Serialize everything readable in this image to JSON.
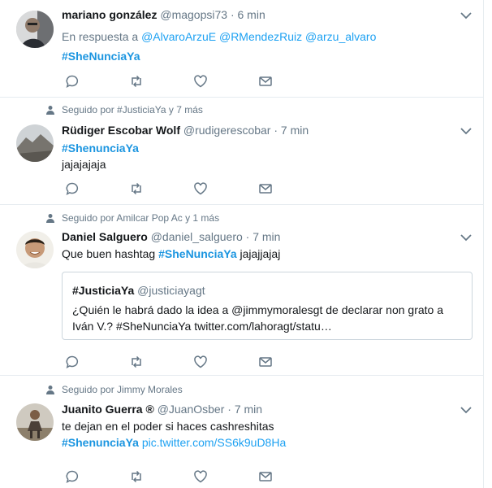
{
  "tweets": [
    {
      "name": "mariano gonzález",
      "handle": "@magopsi73",
      "time": "· 6 min",
      "reply_label": "En respuesta a",
      "reply_to": [
        "@AlvaroArzuE",
        "@RMendezRuiz",
        "@arzu_alvaro"
      ],
      "hashtag": "#SheNunciaYa"
    },
    {
      "social_context": "Seguido por #JusticiaYa y 7 más",
      "name": "Rüdiger Escobar Wolf",
      "handle": "@rudigerescobar",
      "time": "· 7 min",
      "hashtag": "#ShenunciaYa",
      "text": "jajajajaja"
    },
    {
      "social_context": "Seguido por Amilcar Pop Ac y 1 más",
      "name": "Daniel Salguero",
      "handle": "@daniel_salguero",
      "time": "· 7 min",
      "text_before": "Que buen hashtag",
      "hashtag": "#SheNunciaYa",
      "text_after": "jajajjajaj",
      "quote": {
        "name": "#JusticiaYa",
        "handle": "@justiciayagt",
        "line1": "¿Quién le habrá dado la idea a @jimmymoralesgt de declarar non grato a",
        "line2": "Iván V.? #SheNunciaYa twitter.com/lahoragt/statu…"
      }
    },
    {
      "social_context": "Seguido por Jimmy Morales",
      "name": "Juanito Guerra ®",
      "handle": "@JuanOsber",
      "time": "· 7 min",
      "text": "te dejan en el poder si haces cashreshitas",
      "hashtag": "#ShenunciaYa",
      "link": "pic.twitter.com/SS6k9uD8Ha"
    }
  ],
  "colors": {
    "link": "#1da1f2",
    "muted": "#657786",
    "border": "#e6ecf0",
    "text": "#14171a"
  },
  "icons": [
    "person-icon",
    "chevron-down-icon",
    "reply-icon",
    "retweet-icon",
    "like-icon",
    "dm-icon"
  ]
}
